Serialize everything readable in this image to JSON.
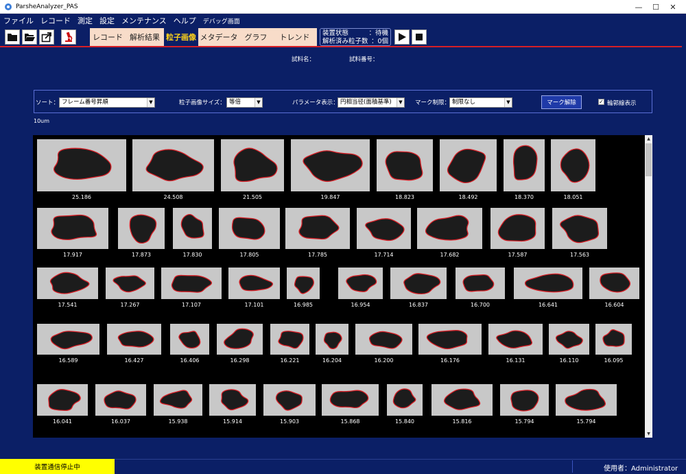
{
  "window": {
    "title": "ParsheAnalyzer_PAS"
  },
  "menu": [
    "ファイル",
    "レコード",
    "測定",
    "設定",
    "メンテナンス",
    "ヘルプ",
    "デバッグ画面"
  ],
  "tabs": [
    {
      "label": "レコード",
      "active": false
    },
    {
      "label": "解析結果",
      "active": false
    },
    {
      "label": "粒子画像",
      "active": true
    },
    {
      "label": "メタデータ",
      "active": false
    },
    {
      "label": "グラフ",
      "active": false
    },
    {
      "label": "トレンド",
      "active": false
    }
  ],
  "status": {
    "device_label": "装置状態",
    "device_value": "待機",
    "count_label": "解析済み粒子数",
    "count_value": "0個"
  },
  "sample": {
    "name_label": "試料名：",
    "number_label": "試料番号："
  },
  "filters": {
    "sort_label": "ソート：",
    "sort_value": "フレーム番号昇順",
    "size_label": "粒子画像サイズ：",
    "size_value": "等倍",
    "param_label": "パラメータ表示：",
    "param_value": "円相当径(面積基準)",
    "mark_label": "マーク制限：",
    "mark_value": "制限なし",
    "mark_clear_button": "マーク解除",
    "outline_label": "輪郭線表示",
    "outline_checked": true
  },
  "scale_label": "10um",
  "particle_values": [
    [
      "25.186",
      "24.508",
      "21.505",
      "19.847",
      "18.823",
      "18.492",
      "18.370",
      "18.051"
    ],
    [
      "17.917",
      "17.873",
      "17.830",
      "17.805",
      "17.785",
      "17.714",
      "17.682",
      "17.587",
      "17.563"
    ],
    [
      "17.541",
      "17.267",
      "17.107",
      "17.101",
      "16.985",
      "16.954",
      "16.837",
      "16.700",
      "16.641",
      "16.604"
    ],
    [
      "16.589",
      "16.427",
      "16.406",
      "16.298",
      "16.221",
      "16.204",
      "16.200",
      "16.176",
      "16.131",
      "16.110",
      "16.095"
    ],
    [
      "16.041",
      "16.037",
      "15.938",
      "15.914",
      "15.903",
      "15.868",
      "15.840",
      "15.816",
      "15.794",
      "15.794"
    ]
  ],
  "footer": {
    "comm_status": "装置通信停止中",
    "user_label": "使用者：Administrator"
  },
  "colors": {
    "background": "#0b1f66",
    "accent_red": "#d71f26",
    "active_tab_text": "#ffd21a",
    "comm_status_bg": "#ffff00",
    "tab_bg": "#f8dcc9"
  }
}
